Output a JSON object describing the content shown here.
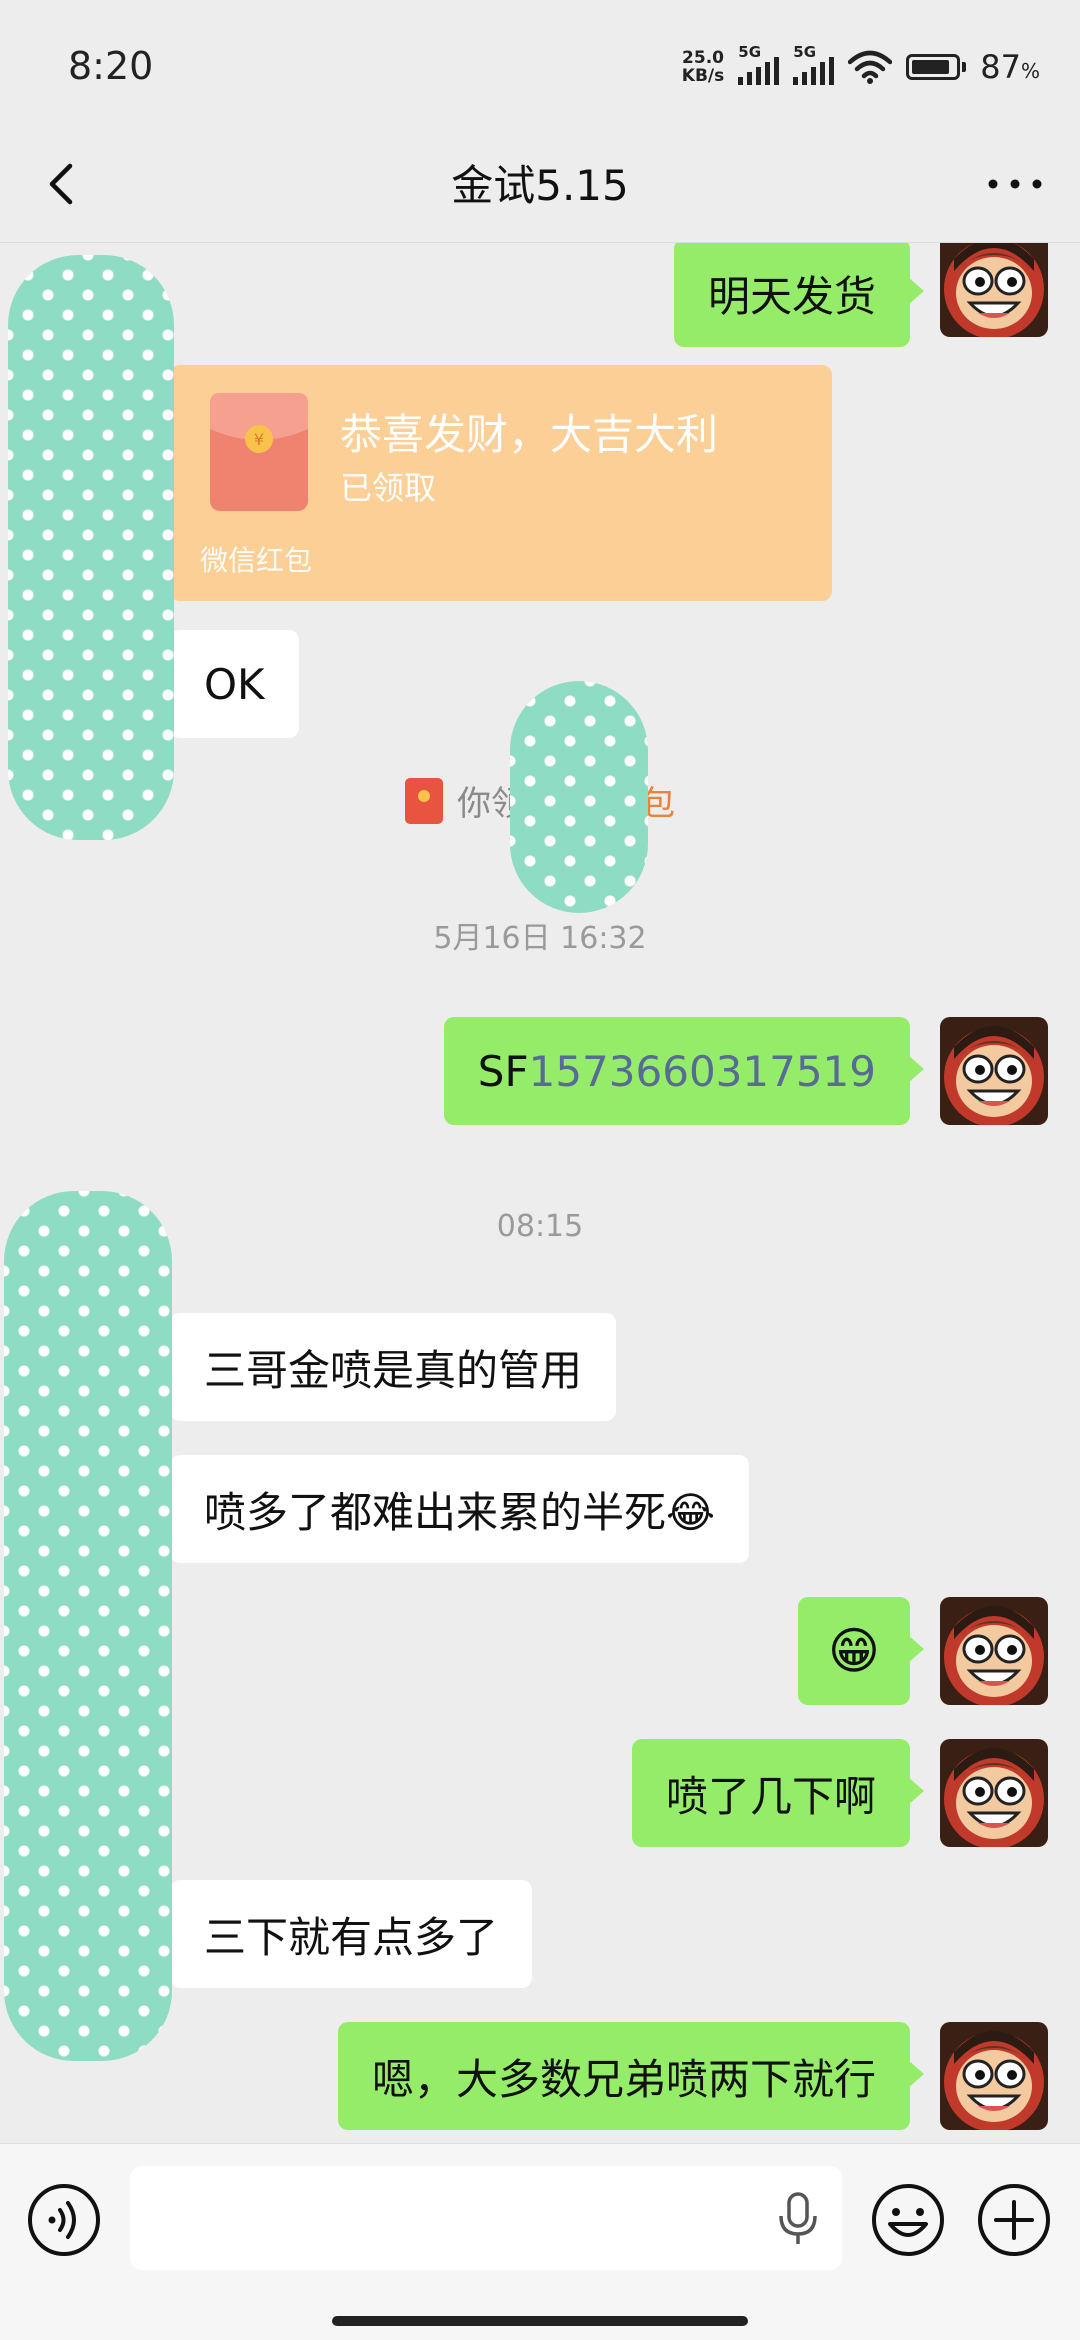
{
  "status_bar": {
    "time": "8:20",
    "net_speed_top": "25.0",
    "net_speed_unit": "KB/s",
    "sim1": "5G",
    "sim2": "5G",
    "battery_percent": "87",
    "battery_percent_sign": "%",
    "battery_level": 0.87
  },
  "header": {
    "title": "金试5.15",
    "back_icon": "chevron-left-icon",
    "more_icon": "more-dots-icon"
  },
  "messages": [
    {
      "from": "me",
      "text": "明天发货"
    },
    {
      "from": "other",
      "type": "red_packet",
      "title": "恭喜发财，大吉大利",
      "status": "已领取",
      "footer": "微信红包"
    },
    {
      "from": "other",
      "text": "OK"
    },
    {
      "type": "system",
      "text_before": "你领取",
      "text_link": "的红包"
    },
    {
      "type": "time",
      "text": "5月16日 16:32"
    },
    {
      "from": "me",
      "prefix": "SF",
      "link": "1573660317519"
    },
    {
      "type": "time",
      "text": "08:15"
    },
    {
      "from": "other",
      "text": "三哥金喷是真的管用"
    },
    {
      "from": "other",
      "text": "喷多了都难出来累的半死😂"
    },
    {
      "from": "me",
      "text": "😁"
    },
    {
      "from": "me",
      "text": "喷了几下啊"
    },
    {
      "from": "other",
      "text": "三下就有点多了"
    },
    {
      "from": "me",
      "text": "嗯，大多数兄弟喷两下就行"
    }
  ],
  "input_bar": {
    "voice_icon": "voice-icon",
    "mic_icon": "microphone-icon",
    "emoji_icon": "emoji-icon",
    "plus_icon": "plus-circle-icon"
  },
  "colors": {
    "my_bubble": "#95ec69",
    "other_bubble": "#ffffff",
    "red_packet": "#fbcf96",
    "link": "#576b95",
    "background": "#ededed",
    "redaction_mask": "#8fdcc4"
  }
}
